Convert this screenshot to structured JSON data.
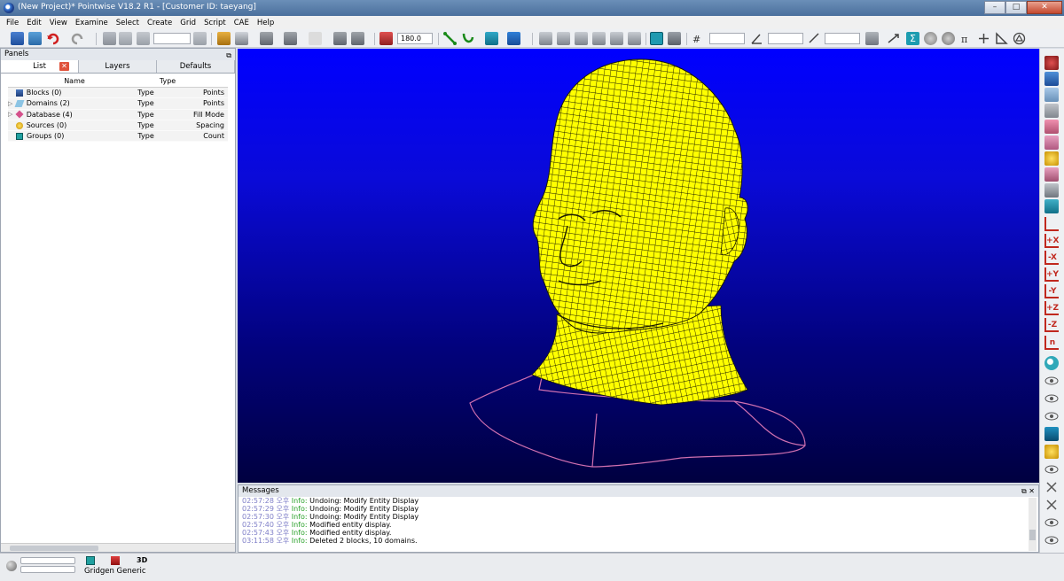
{
  "window": {
    "title": "(New Project)* Pointwise V18.2 R1 - [Customer ID: taeyang]",
    "controls": {
      "minimize": "–",
      "maximize": "□",
      "close": "✕"
    }
  },
  "menu": [
    "File",
    "Edit",
    "View",
    "Examine",
    "Select",
    "Create",
    "Grid",
    "Script",
    "CAE",
    "Help"
  ],
  "toolbar": {
    "angle_value": "180.0",
    "icons": [
      "save-icon",
      "save-as-icon",
      "undo-icon",
      "redo-icon",
      "transform-icon",
      "split-icon",
      "join-icon",
      "paint-icon",
      "shade-icon",
      "view-icon",
      "connector-icon",
      "domain-icon",
      "block-icon",
      "grid-icon",
      "measure-icon",
      "spacing-icon",
      "solver-icon",
      "examine-icon"
    ]
  },
  "panels": {
    "title": "Panels",
    "tabs": [
      "List",
      "Layers",
      "Defaults"
    ],
    "columns": {
      "name": "Name",
      "type": "Type"
    },
    "rows": [
      {
        "label": "Blocks (0)",
        "type": "Type",
        "prop": "Points",
        "expandable": false,
        "icon": "block-icon",
        "color": "#2b4f8a"
      },
      {
        "label": "Domains (2)",
        "type": "Type",
        "prop": "Points",
        "expandable": true,
        "icon": "domain-icon",
        "color": "#6fb0d8"
      },
      {
        "label": "Database (4)",
        "type": "Type",
        "prop": "Fill Mode",
        "expandable": true,
        "icon": "database-icon",
        "color": "#d4508a"
      },
      {
        "label": "Sources (0)",
        "type": "Type",
        "prop": "Spacing",
        "expandable": false,
        "icon": "source-icon",
        "color": "#e8c020"
      },
      {
        "label": "Groups (0)",
        "type": "Type",
        "prop": "Count",
        "expandable": false,
        "icon": "group-icon",
        "color": "#20a0a0"
      }
    ]
  },
  "viewport": {
    "background_top": "#0000ff",
    "background_bottom": "#000040",
    "mesh_color": "#ffff00",
    "database_curve_color": "#d070b0"
  },
  "messages": {
    "title": "Messages",
    "lines": [
      {
        "time": "02:57:28 오후",
        "level": "Info:",
        "text": "Undoing: Modify Entity Display"
      },
      {
        "time": "02:57:29 오후",
        "level": "Info:",
        "text": "Undoing: Modify Entity Display"
      },
      {
        "time": "02:57:30 오후",
        "level": "Info:",
        "text": "Undoing: Modify Entity Display"
      },
      {
        "time": "02:57:40 오후",
        "level": "Info:",
        "text": "Modified entity display."
      },
      {
        "time": "02:57:43 오후",
        "level": "Info:",
        "text": "Modified entity display."
      },
      {
        "time": "03:11:58 오후",
        "level": "Info:",
        "text": "Deleted 2 blocks, 10 domains."
      }
    ]
  },
  "status": {
    "solver": "Gridgen Generic",
    "mode": "3D"
  },
  "right_toolbar": {
    "axis_labels": [
      "",
      "+X",
      "-X",
      "+Y",
      "-Y",
      "+Z",
      "-Z",
      "n"
    ]
  }
}
